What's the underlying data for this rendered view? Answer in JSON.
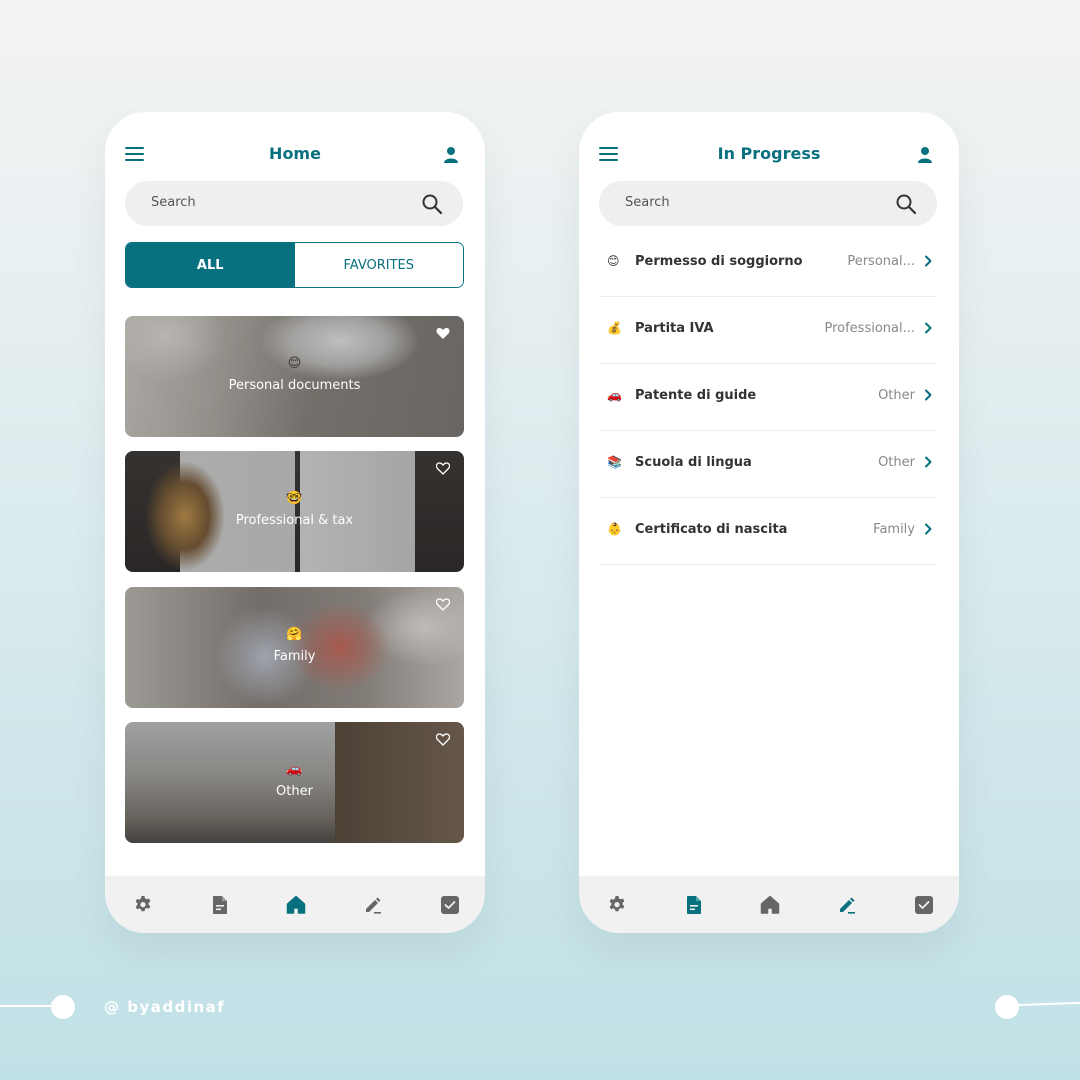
{
  "colors": {
    "accent": "#08707e",
    "inactive_icon": "#666666",
    "white": "#ffffff"
  },
  "home": {
    "title": "Home",
    "search_placeholder": "Search",
    "tabs": [
      {
        "label": "ALL",
        "active": true
      },
      {
        "label": "FAVORITES",
        "active": false
      }
    ],
    "cards": [
      {
        "emoji": "😊",
        "label": "Personal documents",
        "favorite": true
      },
      {
        "emoji": "🤓",
        "label": "Professional & tax",
        "favorite": false
      },
      {
        "emoji": "🤗",
        "label": "Family",
        "favorite": false
      },
      {
        "emoji": "🚗",
        "label": "Other",
        "favorite": false
      }
    ],
    "active_nav": "home"
  },
  "progress": {
    "title": "In Progress",
    "search_placeholder": "Search",
    "items": [
      {
        "emoji": "😊",
        "name": "Permesso di soggiorno",
        "category": "Personal..."
      },
      {
        "emoji": "💰",
        "name": "Partita IVA",
        "category": "Professional..."
      },
      {
        "emoji": "🚗",
        "name": "Patente di guide",
        "category": "Other"
      },
      {
        "emoji": "📚",
        "name": "Scuola di lingua",
        "category": "Other"
      },
      {
        "emoji": "👶",
        "name": "Certificato di nascita",
        "category": "Family"
      }
    ],
    "active_nav": [
      "documents",
      "edit"
    ]
  },
  "nav_icons": [
    "gear-icon",
    "document-icon",
    "home-icon",
    "pencil-icon",
    "checkbox-icon"
  ],
  "credit": "@ byaddinaf"
}
